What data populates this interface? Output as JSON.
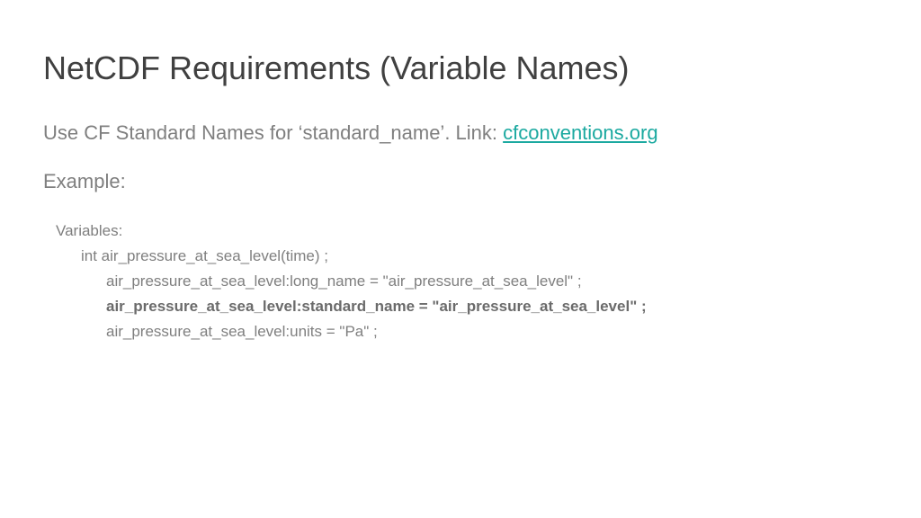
{
  "title": "NetCDF Requirements (Variable Names)",
  "subtitle_prefix": "Use CF Standard Names for ‘standard_name’. Link: ",
  "link_text": "cfconventions.org",
  "example_label": "Example:",
  "code": {
    "line0": "Variables:",
    "line1": "int air_pressure_at_sea_level(time) ;",
    "line2": "air_pressure_at_sea_level:long_name = \"air_pressure_at_sea_level\" ;",
    "line3": "air_pressure_at_sea_level:standard_name =  \"air_pressure_at_sea_level\" ;",
    "line4": "air_pressure_at_sea_level:units = \"Pa\" ;"
  }
}
